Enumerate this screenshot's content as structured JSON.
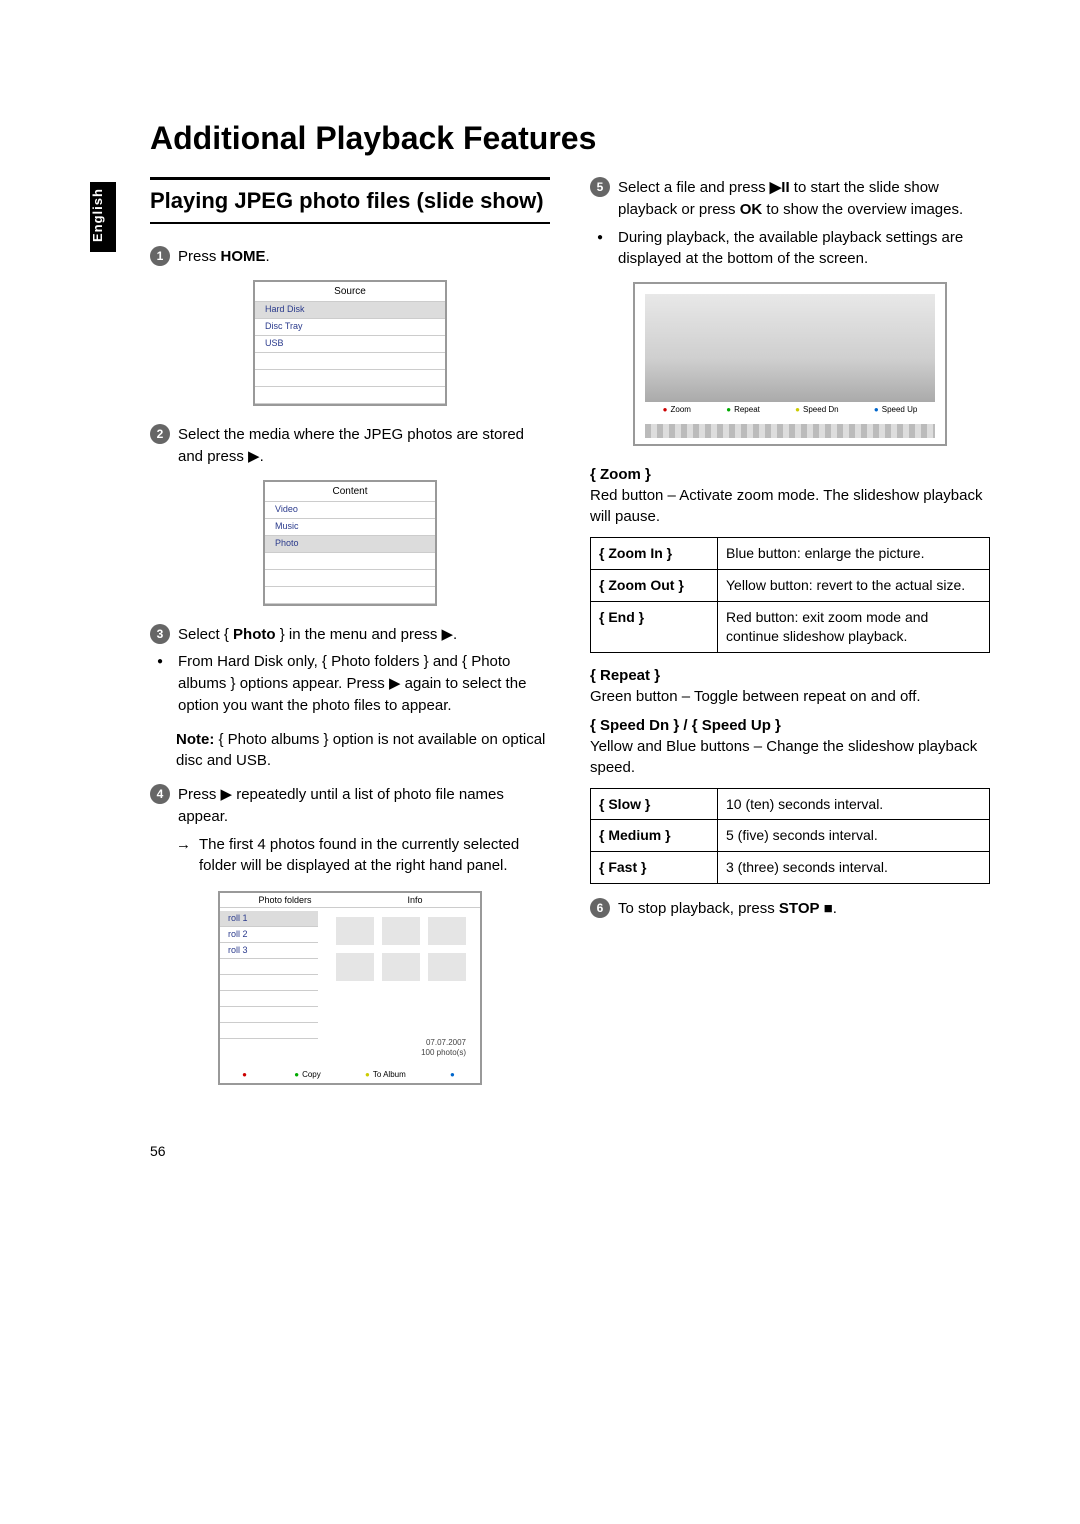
{
  "language_tab": "English",
  "page_title": "Additional Playback Features",
  "page_number": "56",
  "section_heading": "Playing JPEG photo files (slide show)",
  "steps": {
    "s1": {
      "num": "1",
      "text_before": "Press ",
      "bold": "HOME",
      "text_after": "."
    },
    "s2": {
      "num": "2",
      "text": "Select the media where the JPEG photos are stored and press ▶."
    },
    "s3": {
      "num": "3",
      "text_before": "Select { ",
      "bold": "Photo",
      "text_after": " } in the menu and press ▶."
    },
    "s3_bullet": "From Hard Disk only, { Photo folders } and { Photo albums } options appear. Press ▶ again to select the option you want the photo files to appear.",
    "s3_note_bold": "Note:",
    "s3_note_rest": "  { Photo albums } option is not available on optical disc and USB.",
    "s4": {
      "num": "4",
      "text": "Press ▶ repeatedly until a list of photo file names appear."
    },
    "s4_arrow": "The first 4 photos found in the currently selected folder will be displayed at the right hand panel.",
    "s5": {
      "num": "5",
      "text_a": "Select a file and press ",
      "bold1": "▶II",
      "text_b": " to start the slide show playback or press ",
      "bold2": "OK",
      "text_c": " to show the overview images."
    },
    "s5_bullet": "During playback, the available playback settings are displayed at the bottom of the screen.",
    "s6": {
      "num": "6",
      "text_a": "To stop playback, press ",
      "bold": "STOP",
      "text_b": " ■."
    }
  },
  "source_menu": {
    "title": "Source",
    "items": [
      "Hard Disk",
      "Disc Tray",
      "USB"
    ]
  },
  "content_menu": {
    "title": "Content",
    "items": [
      "Video",
      "Music",
      "Photo"
    ],
    "highlighted": 2
  },
  "photo_browser": {
    "head_left": "Photo folders",
    "head_right": "Info",
    "rolls": [
      "roll 1",
      "roll 2",
      "roll 3"
    ],
    "date": "07.07.2007",
    "count": "100 photo(s)",
    "legend": [
      "",
      "Copy",
      "To Album",
      ""
    ]
  },
  "playback_bar": [
    "Zoom",
    "Repeat",
    "Speed Dn",
    "Speed Up"
  ],
  "zoom": {
    "head": "{ Zoom }",
    "desc": "Red button – Activate zoom mode.  The slideshow playback will pause.",
    "rows": [
      {
        "l": "{ Zoom In }",
        "r": "Blue button: enlarge the picture."
      },
      {
        "l": "{ Zoom Out }",
        "r": "Yellow button: revert to the actual size."
      },
      {
        "l": "{ End }",
        "r": "Red button: exit zoom mode and continue slideshow playback."
      }
    ]
  },
  "repeat": {
    "head": "{ Repeat }",
    "desc": "Green button – Toggle between repeat on and off."
  },
  "speed": {
    "head": "{ Speed Dn } / { Speed Up }",
    "desc": "Yellow and Blue buttons – Change the slideshow playback speed.",
    "rows": [
      {
        "l": "{ Slow }",
        "r": "10 (ten) seconds interval."
      },
      {
        "l": "{ Medium }",
        "r": "5 (five) seconds interval."
      },
      {
        "l": "{ Fast }",
        "r": "3 (three) seconds interval."
      }
    ]
  }
}
